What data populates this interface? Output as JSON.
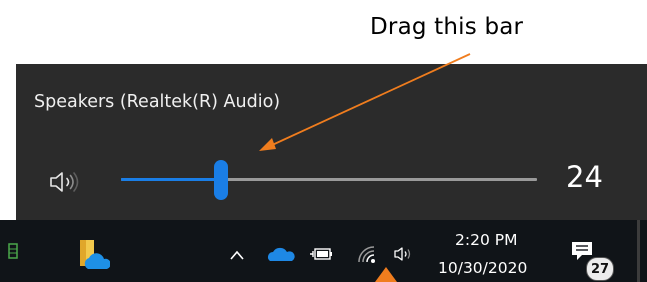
{
  "annotation": {
    "text": "Drag this bar"
  },
  "volume_flyout": {
    "device_name": "Speakers (Realtek(R) Audio)",
    "volume": 24,
    "slider_fraction": 0.24,
    "accent_color": "#1a7ee6",
    "speaker_icon": "speaker-volume-icon"
  },
  "taskbar": {
    "icons": [
      "app-icon",
      "file-explorer-icon",
      "show-hidden-icons-chevron",
      "onedrive-cloud-icon",
      "battery-plug-icon",
      "wifi-icon",
      "speaker-icon"
    ],
    "clock": {
      "time": "2:20 PM",
      "date": "10/30/2020"
    },
    "notifications": {
      "count": "27",
      "icon": "action-center-icon"
    }
  },
  "arrow_color": "#f07d1e"
}
